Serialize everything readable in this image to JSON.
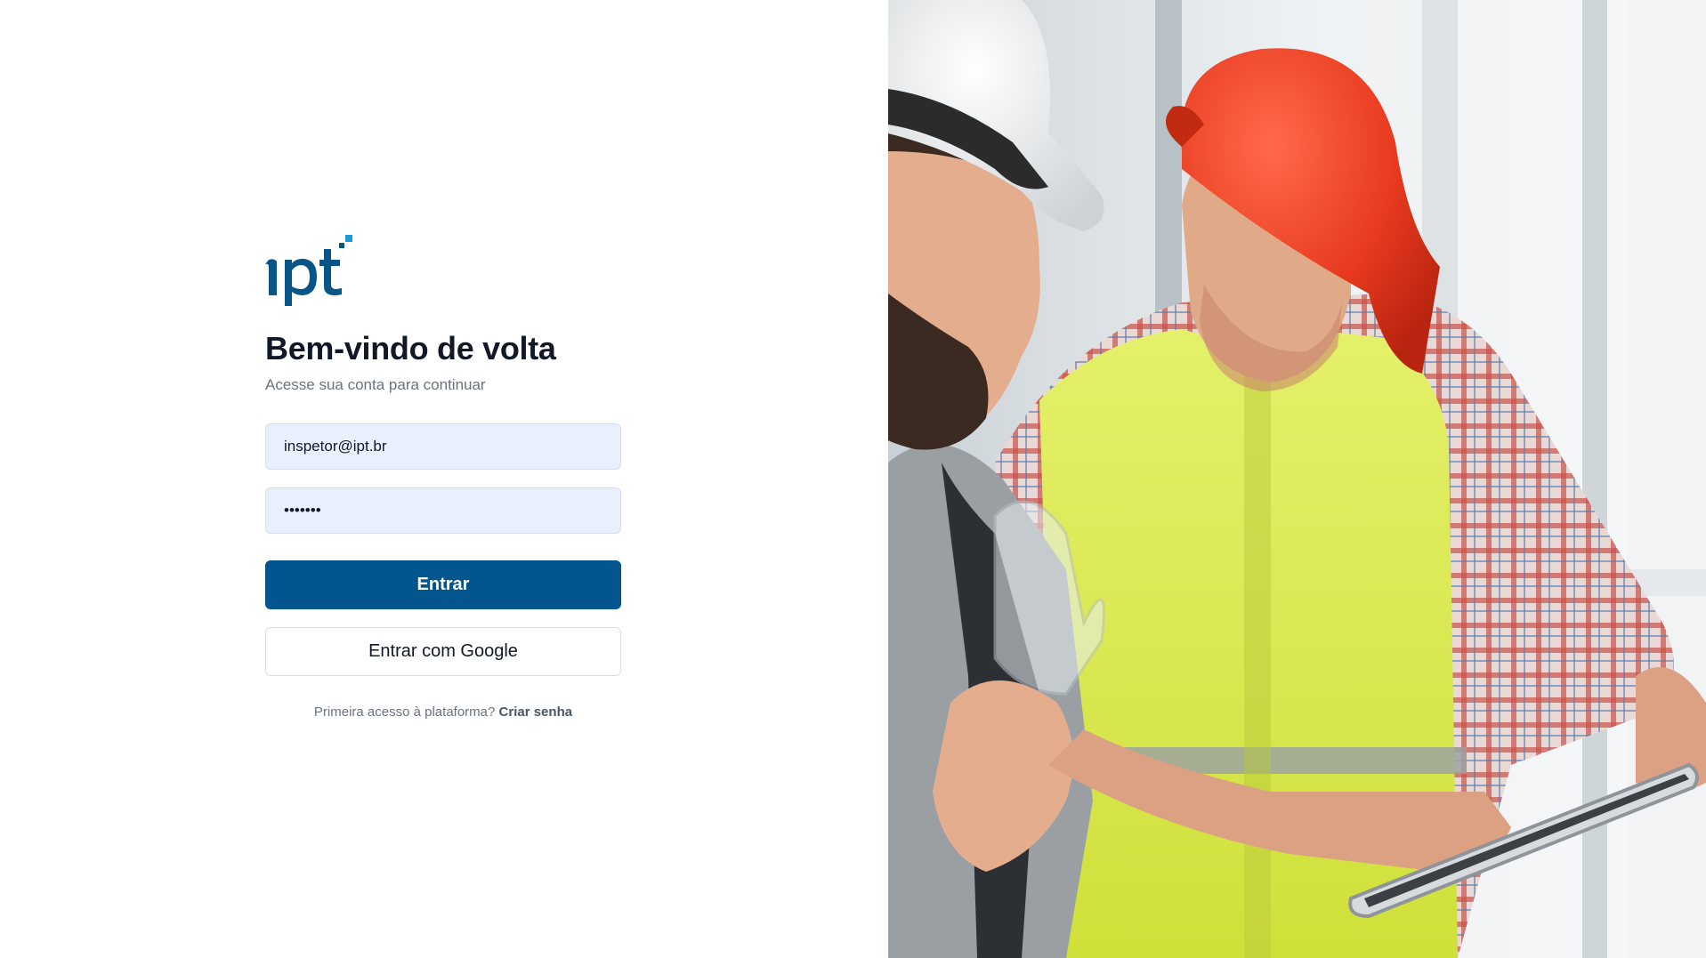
{
  "brand": {
    "logo_text": "ipt",
    "logo_color": "#0a5587",
    "accent_color": "#1a9ad6"
  },
  "login": {
    "title": "Bem-vindo de volta",
    "subtitle": "Acesse sua conta para continuar",
    "email_value": "inspetor@ipt.br",
    "password_value": "•••••••",
    "submit_label": "Entrar",
    "google_label": "Entrar com Google",
    "first_access_text": "Primeira acesso à plataforma?",
    "create_password_link": "Criar senha",
    "primary_color": "#03558d"
  },
  "hero": {
    "image_description_icon": "construction-workers-photo"
  }
}
